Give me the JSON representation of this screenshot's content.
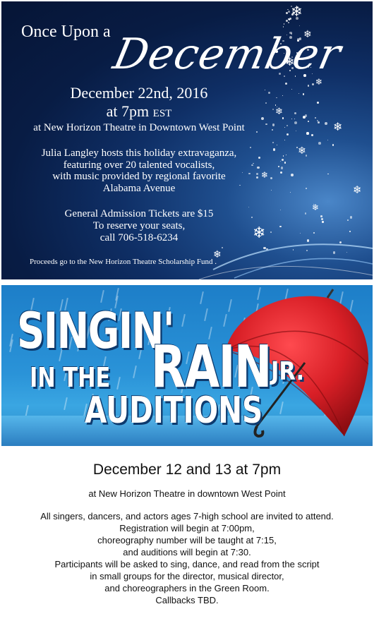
{
  "poster": {
    "title_line1": "Once Upon a",
    "title_line2": "December",
    "date": "December 22nd, 2016",
    "time": "at 7pm",
    "time_zone": "EST",
    "venue": "at New Horizon Theatre in Downtown West Point",
    "description": [
      "Julia Langley hosts this holiday extravaganza,",
      "featuring over 20 talented vocalists,",
      "with music provided by regional favorite",
      "Alabama Avenue"
    ],
    "tickets": [
      "General Admission Tickets are $15",
      "To reserve your seats,",
      "call 706-518-6234"
    ],
    "proceeds": "Proceeds go to the New Horizon Theatre Scholarship Fund ."
  },
  "banner": {
    "word_singin": "SINGIN'",
    "word_in_the": "IN THE",
    "word_rain": "RAIN",
    "word_jr": "JR.",
    "word_auditions": "AUDITIONS",
    "umbrella_color": "#d81f26"
  },
  "info": {
    "date": "December 12 and 13 at 7pm",
    "venue": "at New Horizon Theatre in downtown West Point",
    "details": [
      "All singers, dancers, and actors ages 7-high school are invited to attend.",
      "Registration will begin at 7:00pm,",
      "choreography number will be taught at 7:15,",
      "and auditions will begin at 7:30.",
      "Participants will be asked to sing, dance, and read from the script",
      "in small groups for the director, musical director,",
      "and choreographers in the Green Room.",
      "Callbacks TBD."
    ]
  }
}
